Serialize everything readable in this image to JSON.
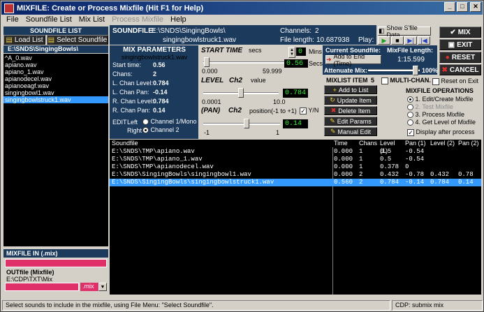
{
  "window": {
    "title": "MIXFILE: Create or Process Mixfile (Hit F1 for Help)"
  },
  "menu": [
    {
      "label": "File",
      "disabled": false
    },
    {
      "label": "Soundfile List",
      "disabled": false
    },
    {
      "label": "Mix List",
      "disabled": false
    },
    {
      "label": "Process Mixfile",
      "disabled": true
    },
    {
      "label": "Help",
      "disabled": false
    }
  ],
  "soundfile_list": {
    "header": "SOUNDFILE LIST",
    "load_label": "Load List",
    "select_label": "Select Soundfile",
    "path": "E:\\SNDS\\SingingBowls\\",
    "files": [
      "^A_0.wav",
      "apiano.wav",
      "apiano_1.wav",
      "apianodecel.wav",
      "apianoeagf.wav",
      "singingbowl1.wav",
      "singingbowlstruck1.wav"
    ],
    "selected_index": 6
  },
  "soundfile_bar": {
    "label": "SOUNDFILE:",
    "path": "E:\\SNDS\\SingingBowls\\",
    "name": "singingbowlstruck1.wav",
    "channels_label": "Channels:",
    "channels": "2",
    "length_label": "File length:",
    "length": "10.687938",
    "play_label": "Play:",
    "show_sfile_label": "Show S'file Data"
  },
  "mix_params": {
    "header": "MIX PARAMETERS",
    "filename": "singingbowlstruck1.wav",
    "rows": [
      {
        "label": "Start time:",
        "value": "0.56"
      },
      {
        "label": "Chans:",
        "value": "2"
      },
      {
        "label": "L. Chan Level:",
        "value": "0.784"
      },
      {
        "label": "L. Chan Pan:",
        "value": "-0.14"
      },
      {
        "label": "R. Chan Level:",
        "value": "0.784"
      },
      {
        "label": "R. Chan Pan:",
        "value": "0.14"
      }
    ],
    "edit_label": "EDIT",
    "left_label": "Left",
    "right_label": "Right",
    "ch1_label": "Channel 1/Mono",
    "ch2_label": "Channel 2"
  },
  "start_time": {
    "label": "START TIME",
    "unit": "secs",
    "min": "0.000",
    "max": "59.999",
    "value": "0.56",
    "fraction": 0.009,
    "mins_value": "0",
    "mins_label": "Mins",
    "secs_label": "Secs"
  },
  "level": {
    "label": "LEVEL",
    "ch": "Ch2",
    "unit": "value",
    "min": "0.0001",
    "max": "10.0",
    "value": "0.784",
    "fraction": 0.5
  },
  "pan": {
    "label": "(PAN)",
    "ch": "Ch2",
    "unit": "position(-1 to +1)",
    "min": "-1",
    "max": "1",
    "value": "0.14",
    "fraction": 0.57,
    "yn_label": "Y/N"
  },
  "current": {
    "label": "Current Soundfile:",
    "add_end_label": "Add to End (Time)",
    "mixlen_label": "MixFile Length:",
    "mixlen": "1:15.599",
    "attenuate_label": "Attenuate Mix:",
    "attenuate_pct": "100%",
    "multichan_label": "MULTI-CHAN.",
    "reset_exit_label": "Reset on Exit"
  },
  "mixlist_item": {
    "header": "MIXLIST ITEM",
    "index": "5",
    "buttons": [
      "Add to List",
      "Update Item",
      "Delete Item",
      "Edit Params",
      "Manual Edit"
    ]
  },
  "operations": {
    "header": "MIXFILE OPERATIONS",
    "items": [
      {
        "label": "1. Edit/Create Mixfile",
        "selected": true,
        "disabled": false
      },
      {
        "label": "2. Test Mixfile",
        "selected": false,
        "disabled": true
      },
      {
        "label": "3. Process Mixfile",
        "selected": false,
        "disabled": false
      },
      {
        "label": "4. Get Level of Mixfile",
        "selected": false,
        "disabled": false
      }
    ],
    "display_label": "Display after process"
  },
  "right_buttons": [
    "MIX",
    "EXIT",
    "RESET",
    "CANCEL"
  ],
  "table": {
    "headers": [
      "Soundfile",
      "Time",
      "Chans",
      "Level (1)",
      "Pan (1)",
      "Level (2)",
      "Pan (2)"
    ],
    "rows": [
      [
        "E:\\SNDS\\TMP\\apiano.wav",
        "0.000",
        "1",
        "0.5",
        "-0.54",
        "",
        ""
      ],
      [
        "E:\\SNDS\\TMP\\apiano_1.wav",
        "0.000",
        "1",
        "0.5",
        "-0.54",
        "",
        ""
      ],
      [
        "E:\\SNDS\\TMP\\apianodecel.wav",
        "0.000",
        "1",
        "0.378",
        "0",
        "",
        ""
      ],
      [
        "E:\\SNDS\\SingingBowls\\singingbowl1.wav",
        "0.000",
        "2",
        "0.432",
        "-0.78",
        "0.432",
        "0.78"
      ],
      [
        "E:\\SNDS\\SingingBowls\\singingbowlstruck1.wav",
        "0.560",
        "2",
        "0.784",
        "-0.14",
        "0.784",
        "0.14"
      ]
    ],
    "selected_index": 4
  },
  "mixfile_in": {
    "label": "MIXFILE IN (.mix)"
  },
  "outfile": {
    "label": "OUTfile (Mixfile)",
    "path": "E:\\CDP\\TXT\\Mix",
    "ext": ".mix"
  },
  "status": {
    "left": "Select sounds to include in the mixfile, using File Menu: \"Select Soundfile\".",
    "right": "CDP: submix mix"
  },
  "colors": {
    "navy": "#1b3a5c",
    "lcd_green": "#38f038",
    "selection": "#3399ff",
    "pink": "#e0306a"
  }
}
